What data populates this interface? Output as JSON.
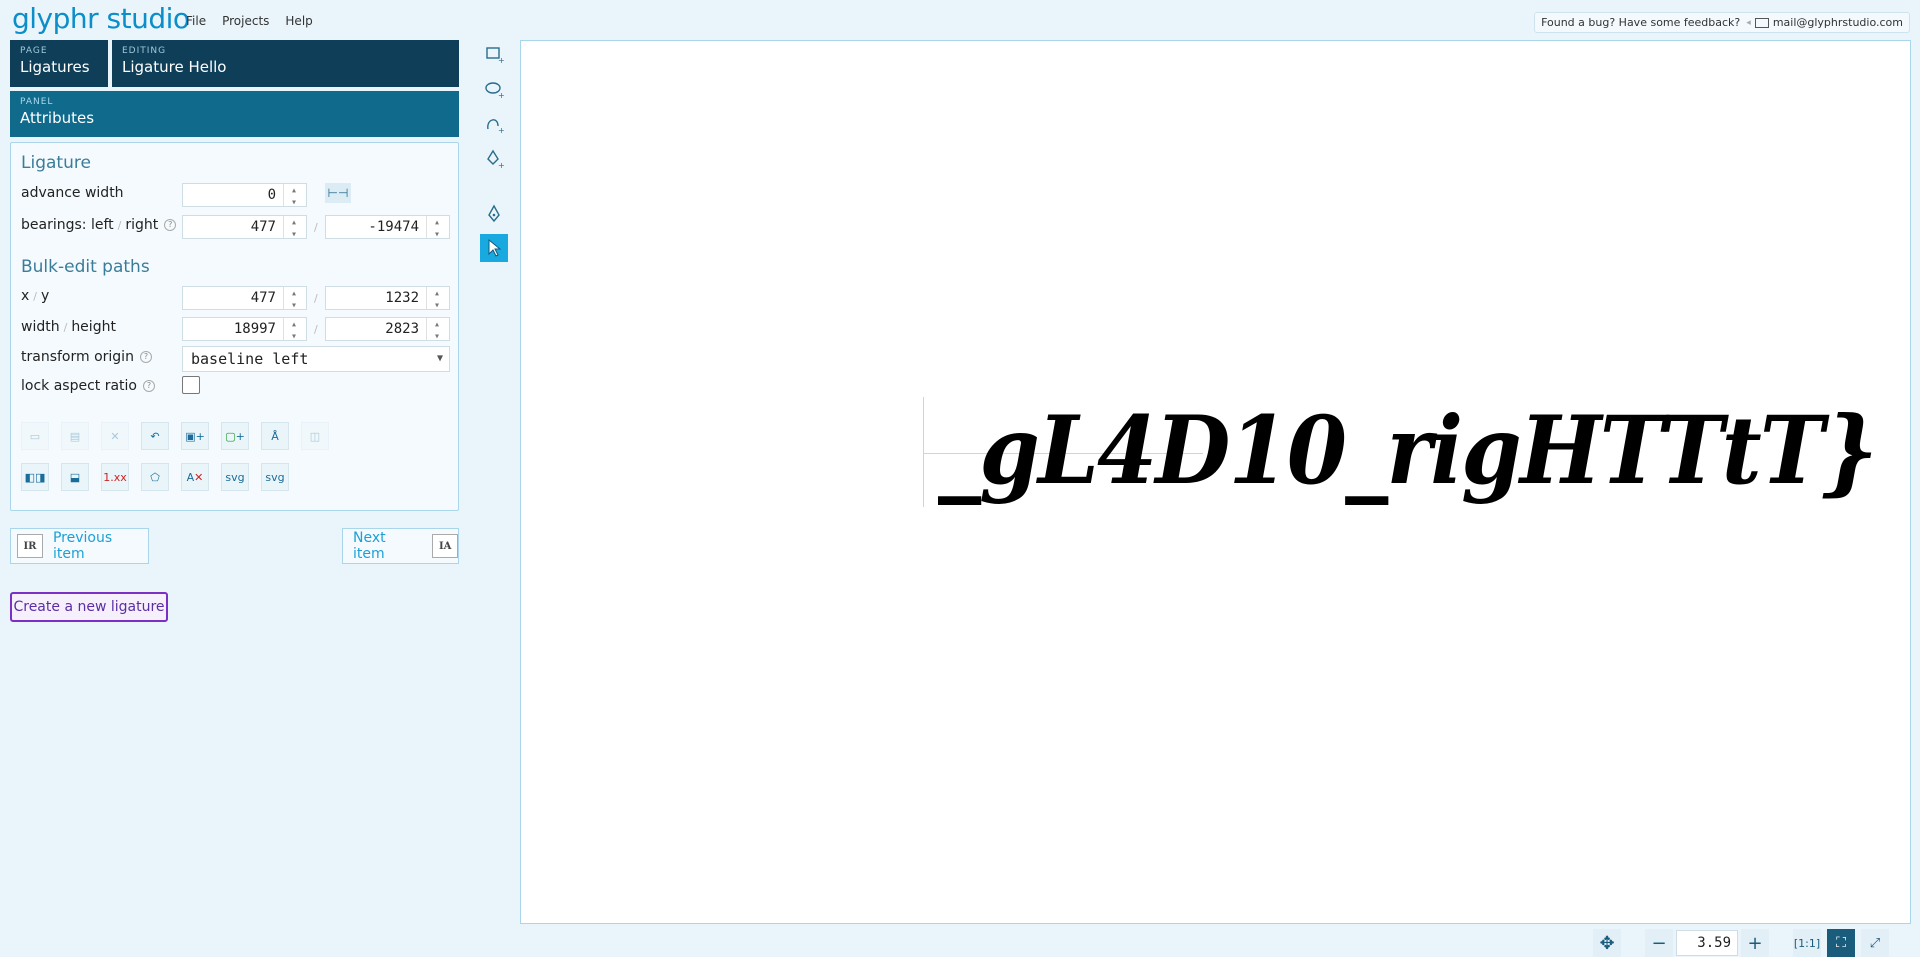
{
  "app": {
    "logo": "glyphr studio"
  },
  "menu": [
    "File",
    "Projects",
    "Help"
  ],
  "feedback": {
    "text": "Found a bug? Have some feedback?",
    "email": "mail@glyphrstudio.com"
  },
  "nav": {
    "page_label": "PAGE",
    "page_value": "Ligatures",
    "editing_label": "EDITING",
    "editing_value": "Ligature Hello",
    "panel_label": "PANEL",
    "panel_value": "Attributes"
  },
  "ligature": {
    "title": "Ligature",
    "advance_width_label": "advance width",
    "advance_width": "0",
    "bearings_label_left": "bearings: left",
    "bearings_label_right": "right",
    "bearing_left": "477",
    "bearing_right": "-19474"
  },
  "bulk": {
    "title": "Bulk-edit paths",
    "x_label": "x",
    "y_label": "y",
    "x": "477",
    "y": "1232",
    "width_label": "width",
    "height_label": "height",
    "width": "18997",
    "height": "2823",
    "transform_origin_label": "transform origin",
    "transform_origin": "baseline left",
    "lock_label": "lock aspect ratio"
  },
  "actions_row1": [
    "copy-icon",
    "paste-icon",
    "delete-icon",
    "undo-icon",
    "add-path-icon",
    "add-component-icon",
    "paste-glyph-icon",
    "combine-icon"
  ],
  "actions_row2": [
    "flip-horizontal-icon",
    "flip-vertical-icon",
    "round-values-icon",
    "reverse-winding-icon",
    "clear-icon",
    "svg-export-icon",
    "svg-import-icon"
  ],
  "action_text": {
    "round": "1.xx",
    "svg": "svg"
  },
  "navigation": {
    "prev": "Previous item",
    "next": "Next item",
    "prev_icon": "IR",
    "next_icon": "IA",
    "create": "Create a new ligature"
  },
  "canvas": {
    "glyph_text": "_gL4D10_rigHTTtT}",
    "zoom": "3.59"
  }
}
